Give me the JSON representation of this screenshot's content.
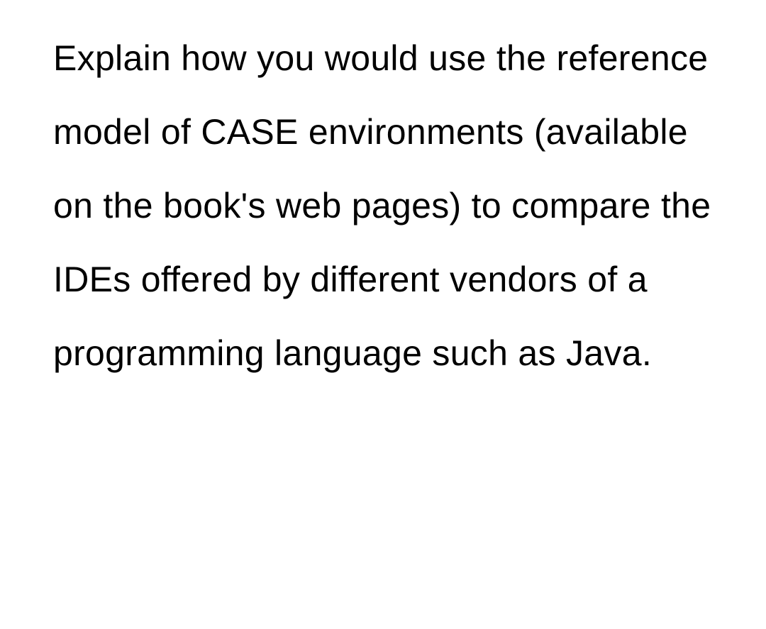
{
  "content": {
    "text": "Explain how you would use the reference model of CASE environments (available on the book's web pages) to compare the IDEs offered by different vendors of a programming language such as Java."
  }
}
